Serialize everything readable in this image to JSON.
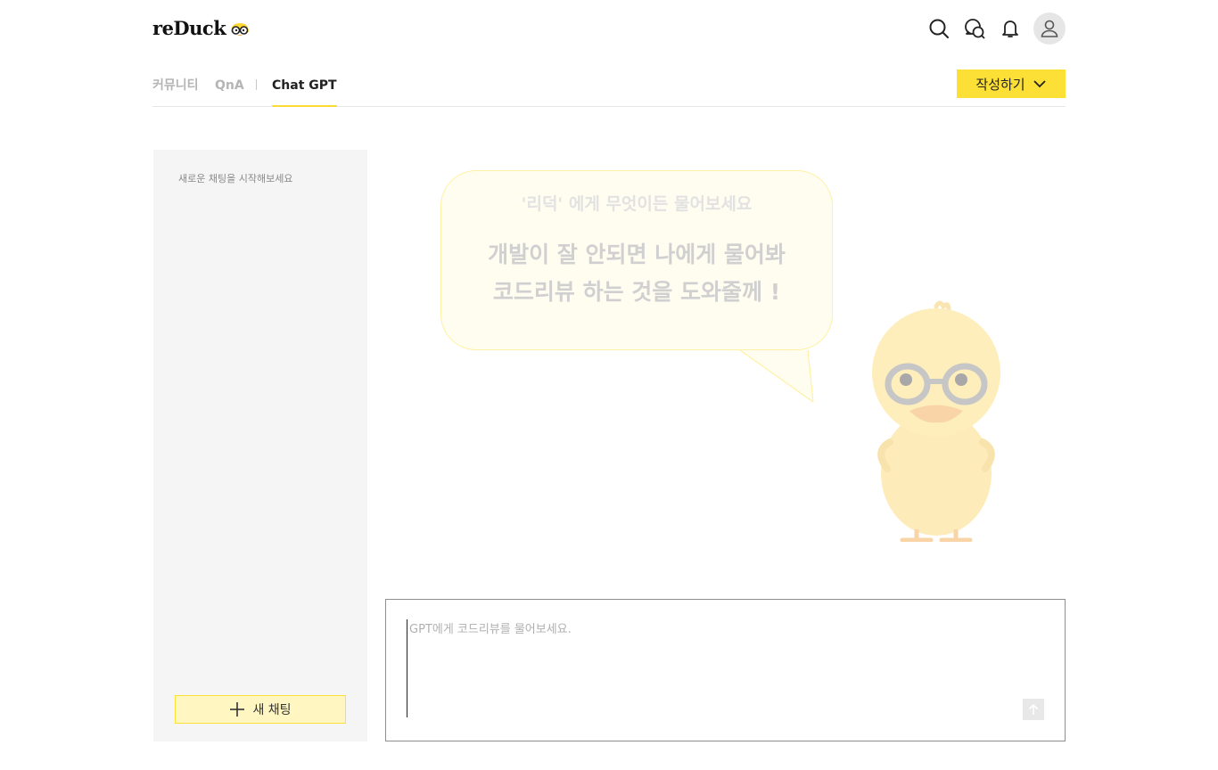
{
  "app": {
    "logo_text": "reDuck",
    "logo_icon": "duck-glasses-logo"
  },
  "header": {
    "icons": [
      "search-icon",
      "chat-icon",
      "bell-icon",
      "user-icon"
    ]
  },
  "nav": {
    "tabs": [
      {
        "label": "커뮤니티",
        "active": false
      },
      {
        "label": "QnA",
        "active": false
      },
      {
        "label": "Chat GPT",
        "active": true
      }
    ],
    "write_button": "작성하기",
    "accent_color": "#fde035"
  },
  "sidebar": {
    "hint": "새로운 채팅을 시작해보세요",
    "new_chat_label": "새 채팅"
  },
  "welcome": {
    "subtitle": "'리덕' 에게 무엇이든 물어보세요",
    "line1": "개발이 잘 안되면 나에게 물어봐",
    "line2": "코드리뷰 하는 것을 도와줄께 !"
  },
  "composer": {
    "placeholder": "GPT에게 코드리뷰를 물어보세요.",
    "value": "",
    "send_icon": "arrow-up-icon"
  }
}
